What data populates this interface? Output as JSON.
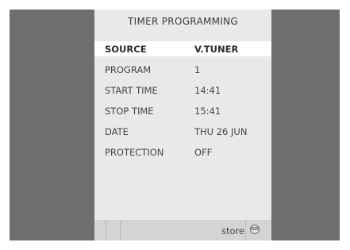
{
  "menu": {
    "title": "TIMER PROGRAMMING",
    "rows": [
      {
        "label": "SOURCE",
        "value": "V.TUNER",
        "selected": true
      },
      {
        "label": "PROGRAM",
        "value": "1"
      },
      {
        "label": "START TIME",
        "value": "14:41"
      },
      {
        "label": "STOP TIME",
        "value": "15:41"
      },
      {
        "label": "DATE",
        "value": "THU 26 JUN"
      },
      {
        "label": "PROTECTION",
        "value": "OFF"
      }
    ]
  },
  "footer": {
    "store_label": "store",
    "go_label": "GO",
    "go_icon": "go-button-icon"
  },
  "colors": {
    "background": "#6e6e6e",
    "menu_panel": "#e9e9e9",
    "selected_row": "#ffffff",
    "footer_bar": "#d4d4d4"
  }
}
